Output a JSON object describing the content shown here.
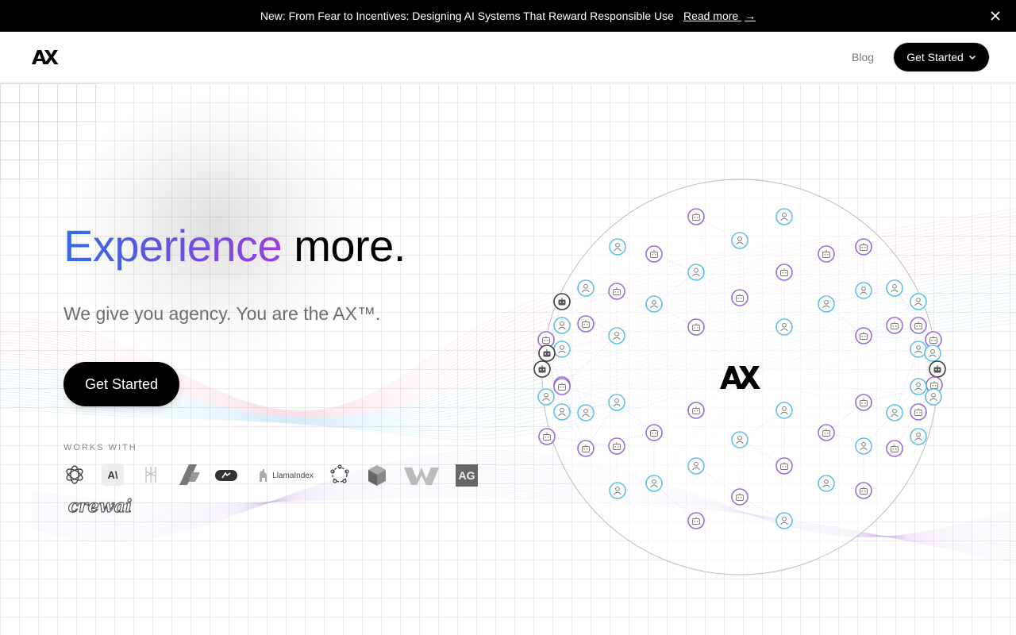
{
  "banner": {
    "message": "New: From Fear to Incentives: Designing AI Systems That Reward Responsible Use",
    "link_label": "Read more",
    "link_arrow": "→",
    "close_icon": "close-icon"
  },
  "nav": {
    "logo_text": "AX",
    "blog_label": "Blog",
    "cta_label": "Get Started",
    "cta_icon": "chevron-down-icon"
  },
  "hero": {
    "title_gradient": "Experience",
    "title_rest": " more.",
    "subtitle": "We give you agency. You are the AX™.",
    "cta_label": "Get Started",
    "gradient_colors": [
      "#2f6bea",
      "#6b4fe0",
      "#9a3fe0"
    ]
  },
  "works_with": {
    "label": "WORKS WITH",
    "partners": [
      {
        "name": "openai-logo"
      },
      {
        "name": "anthropic-logo",
        "text": "A\\"
      },
      {
        "name": "langgraph-logo"
      },
      {
        "name": "fireworks-logo"
      },
      {
        "name": "link-logo"
      },
      {
        "name": "llamaindex-logo",
        "text": "LlamaIndex"
      },
      {
        "name": "network-logo"
      },
      {
        "name": "cube-logo"
      },
      {
        "name": "wordware-logo"
      },
      {
        "name": "autogen-logo",
        "text": "AG"
      },
      {
        "name": "crewai-logo",
        "text": "crewai"
      }
    ]
  },
  "network": {
    "center_text": "AX",
    "colors": {
      "agent": "#9b6cd9",
      "human": "#5cc2e6",
      "dark": "#3a3a3a",
      "edge": "#a58be8"
    }
  }
}
